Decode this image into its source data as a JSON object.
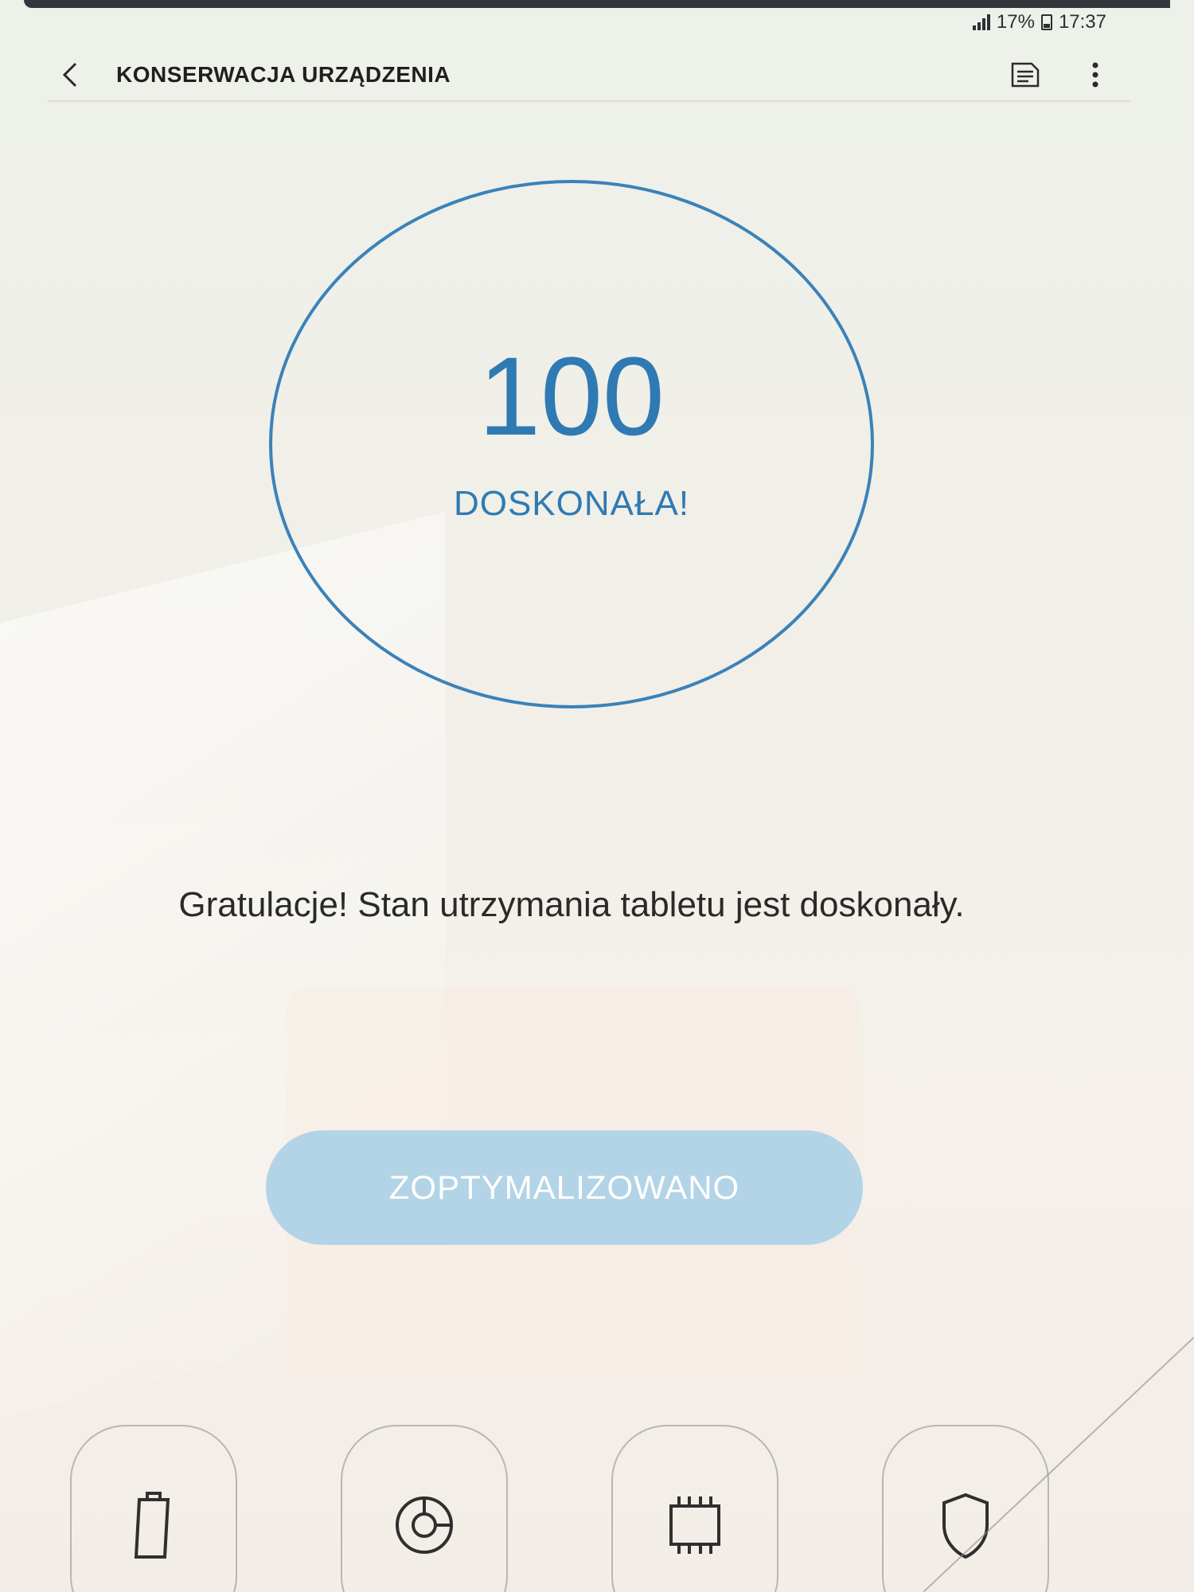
{
  "status_bar": {
    "battery_percent": "17%",
    "time": "17:37"
  },
  "app_bar": {
    "title": "KONSERWACJA URZĄDZENIA",
    "back_icon": "chevron-left-icon",
    "report_icon": "document-icon",
    "more_icon": "more-vertical-icon"
  },
  "score": {
    "value": "100",
    "label": "DOSKONAŁA!",
    "accent_color": "#2f7ab3"
  },
  "message": "Gratulacje! Stan utrzymania tabletu jest doskonały.",
  "optimize_button": {
    "label": "ZOPTYMALIZOWANO",
    "color": "#b3d4e6"
  },
  "tiles": [
    {
      "icon": "battery-icon"
    },
    {
      "icon": "storage-icon"
    },
    {
      "icon": "memory-chip-icon"
    },
    {
      "icon": "shield-icon"
    }
  ]
}
